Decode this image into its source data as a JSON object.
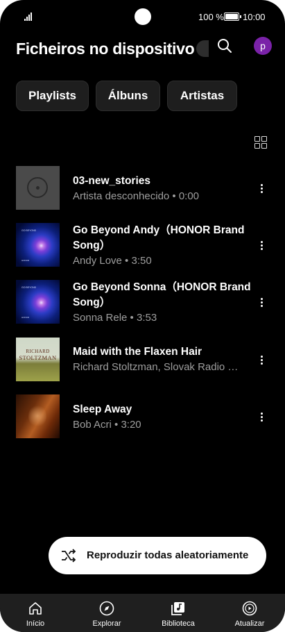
{
  "status_bar": {
    "battery_percent": "100 %",
    "battery_level": 1.0,
    "time": "10:00"
  },
  "header": {
    "title": "Ficheiros no dispositivo",
    "search_icon": "search-icon",
    "avatar_initial": "p",
    "avatar_color": "#7a22a8"
  },
  "filters": [
    "Playlists",
    "Álbuns",
    "Artistas"
  ],
  "view_toggle_icon": "grid-view-icon",
  "tracks": [
    {
      "title": "03-new_stories",
      "subtitle": "Artista desconhecido • 0:00",
      "art": "placeholder-vinyl"
    },
    {
      "title": "Go Beyond Andy（HONOR Brand",
      "title_line2": "Song）",
      "subtitle": "Andy Love • 3:50",
      "art": "honor-blue",
      "art_text_top": "GO BEYOND",
      "art_text_bottom": "HONOR"
    },
    {
      "title": "Go Beyond Sonna（HONOR Brand",
      "title_line2": "Song）",
      "subtitle": "Sonna Rele • 3:53",
      "art": "honor-blue",
      "art_text_top": "GO BEYOND",
      "art_text_bottom": "HONOR"
    },
    {
      "title": "Maid with the Flaxen Hair",
      "subtitle": "Richard Stoltzman, Slovak Radio …",
      "art": "stoltzman-cover",
      "art_text_top": "RICHARD",
      "art_text_bottom": "STOLTZMAN"
    },
    {
      "title": "Sleep Away",
      "subtitle": "Bob Acri • 3:20",
      "art": "sleep-away-cover"
    }
  ],
  "shuffle_all": {
    "label": "Reproduzir todas aleatoriamente",
    "icon": "shuffle-icon"
  },
  "bottom_nav": [
    {
      "label": "Início",
      "icon": "home-icon"
    },
    {
      "label": "Explorar",
      "icon": "compass-icon"
    },
    {
      "label": "Biblioteca",
      "icon": "library-icon",
      "active": true
    },
    {
      "label": "Atualizar",
      "icon": "upgrade-play-icon"
    }
  ],
  "colors": {
    "background": "#000000",
    "chip_background": "#1e1e1e",
    "secondary_text": "#9e9e9e",
    "nav_background": "#1f1f1f",
    "shuffle_button": "#ffffff"
  }
}
